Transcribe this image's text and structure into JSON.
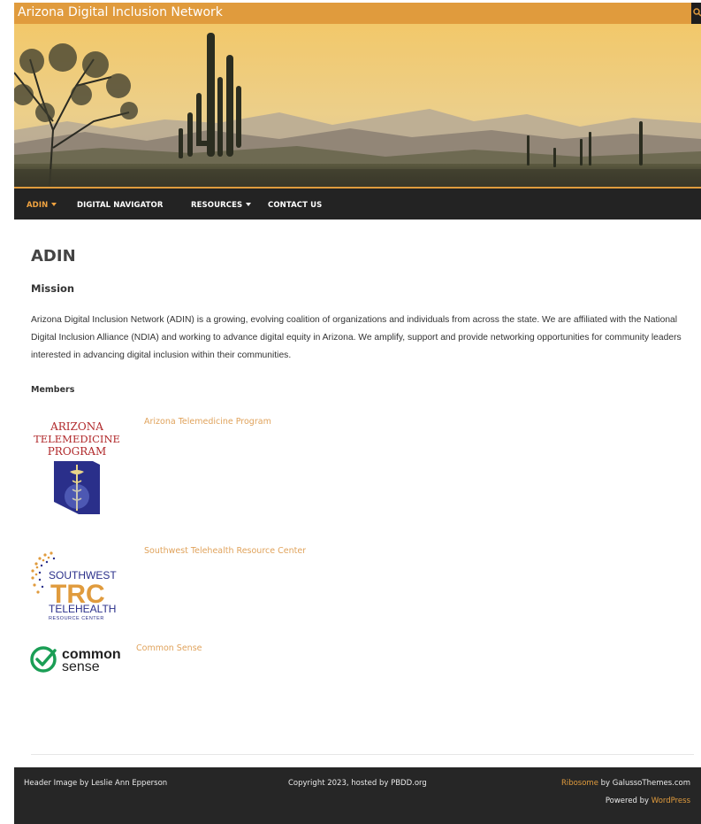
{
  "site": {
    "title": "Arizona Digital Inclusion Network",
    "search_icon": "search-icon"
  },
  "nav": {
    "items": [
      {
        "label": "ADIN",
        "dropdown": true,
        "active": true
      },
      {
        "label": "DIGITAL NAVIGATOR",
        "dropdown": false,
        "active": false
      },
      {
        "label": "RESOURCES",
        "dropdown": true,
        "active": false
      },
      {
        "label": "CONTACT US",
        "dropdown": false,
        "active": false
      }
    ]
  },
  "main": {
    "page_title": "ADIN",
    "mission_heading": "Mission",
    "mission_text": "Arizona Digital Inclusion Network (ADIN) is a growing, evolving coalition of organizations and individuals from across the state. We are affiliated with the National Digital Inclusion Alliance (NDIA) and working to advance digital equity in Arizona. We amplify, support and provide networking opportunities for community leaders interested in advancing digital inclusion within their communities.",
    "members_heading": "Members",
    "members": [
      {
        "name": "Arizona Telemedicine Program",
        "logo_lines": [
          "ARIZONA",
          "TELEMEDICINE",
          "PROGRAM"
        ]
      },
      {
        "name": "Southwest Telehealth Resource Center",
        "logo_lines": [
          "SOUTHWEST",
          "TRC",
          "TELEHEALTH",
          "RESOURCE CENTER"
        ]
      },
      {
        "name": "Common Sense",
        "logo_lines": [
          "common",
          "sense"
        ]
      }
    ]
  },
  "footer": {
    "credit": "Header Image by Leslie Ann Epperson",
    "copyright": "Copyright 2023, hosted by PBDD.org",
    "theme_link": "Ribosome",
    "theme_by": " by GalussoThemes.com",
    "powered_by": "Powered by ",
    "wordpress_link": "WordPress"
  },
  "colors": {
    "accent": "#e09b3d",
    "nav_bg": "#232323",
    "footer_bg": "#262626",
    "link": "#e0a35c"
  }
}
